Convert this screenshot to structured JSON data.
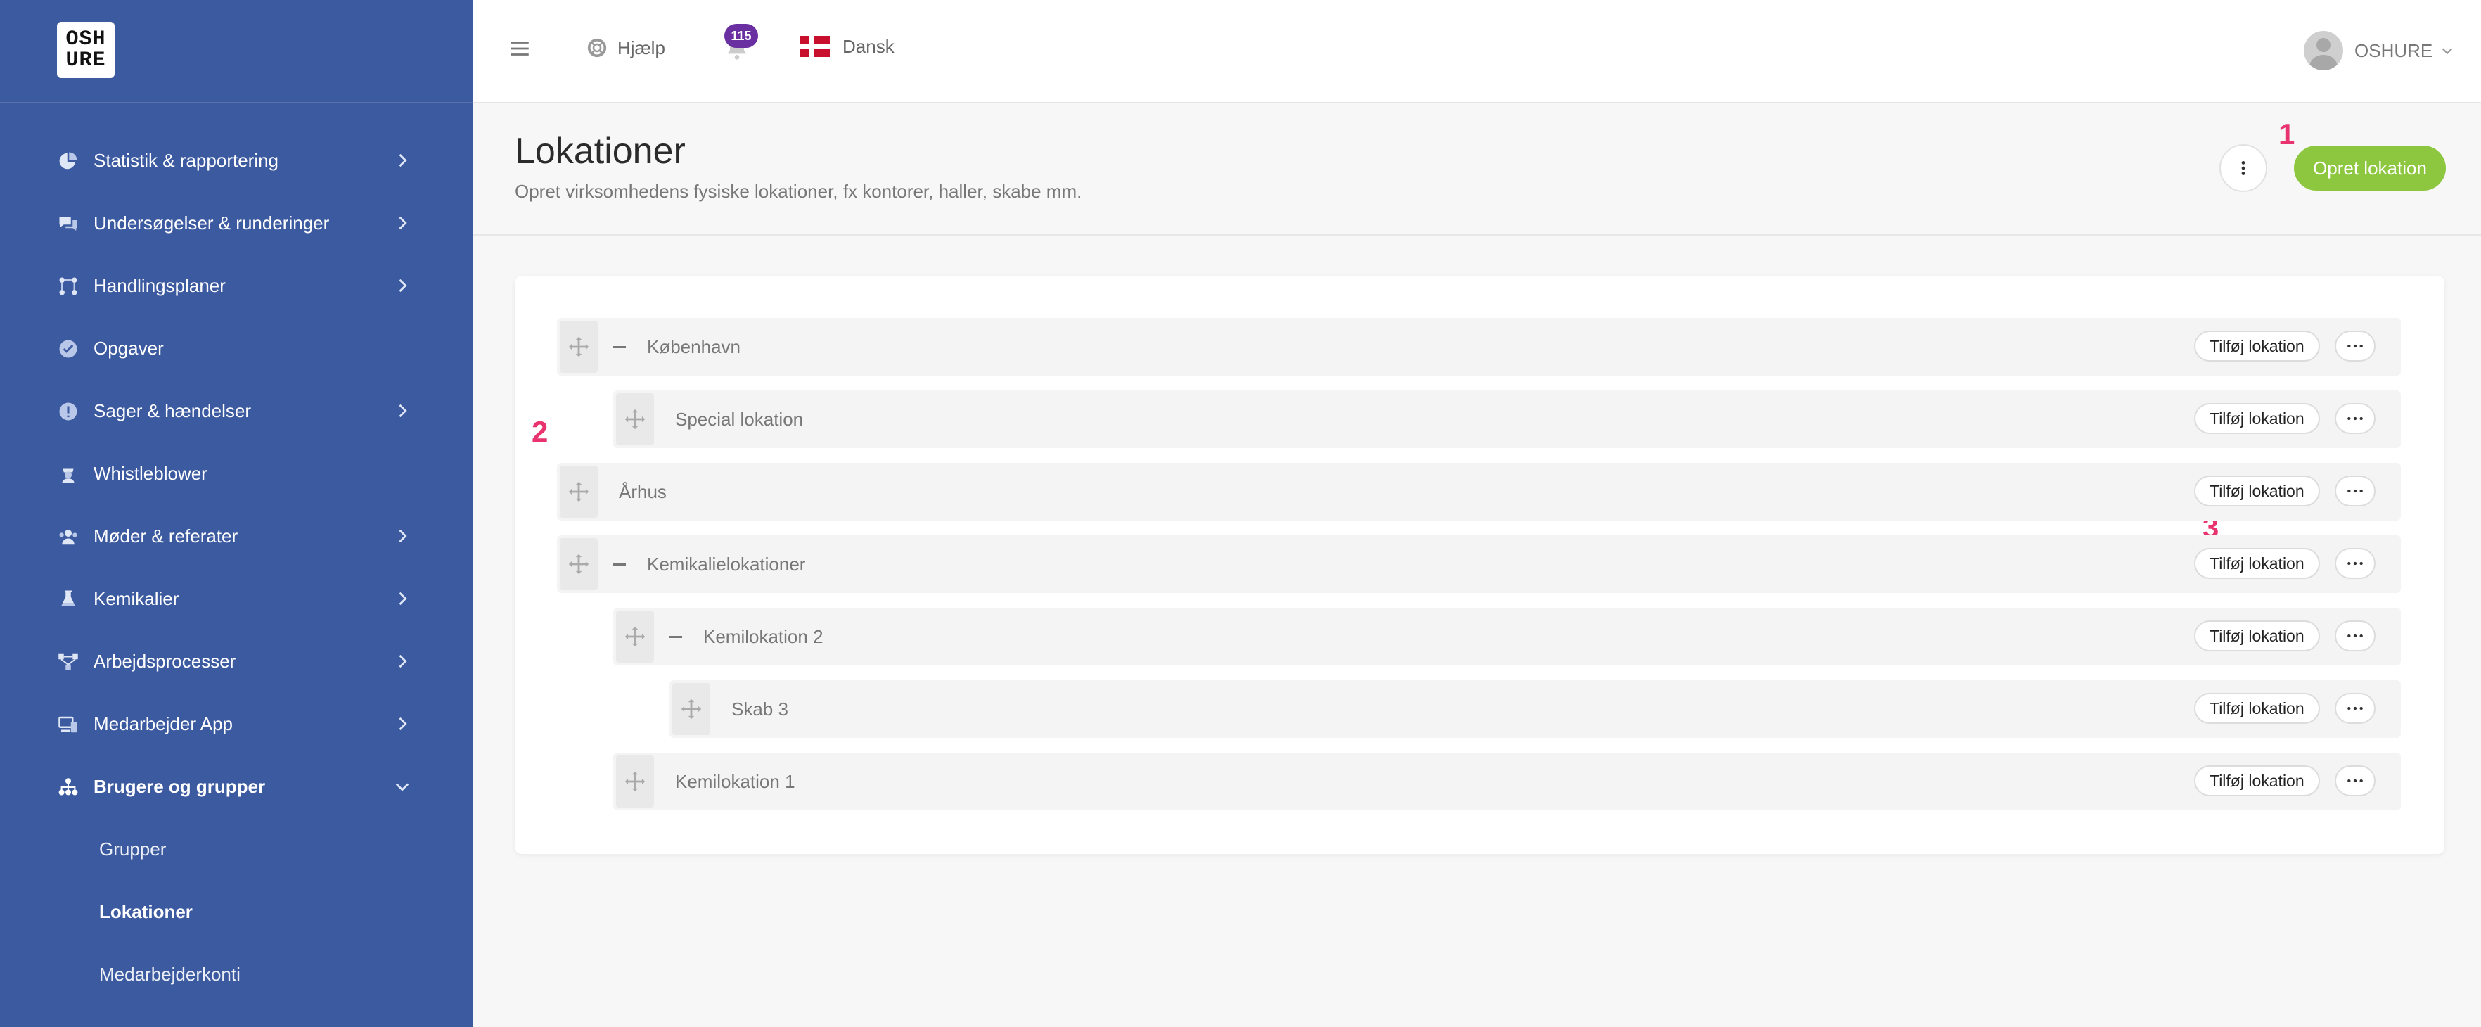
{
  "logo": {
    "line1": "OSH",
    "line2": "URE"
  },
  "sidebar": {
    "items": [
      {
        "label": "Statistik & rapportering",
        "icon": "pie-chart-icon"
      },
      {
        "label": "Undersøgelser & runderinger",
        "icon": "chat-bubbles-icon"
      },
      {
        "label": "Handlingsplaner",
        "icon": "action-plan-icon"
      },
      {
        "label": "Opgaver",
        "icon": "check-circle-icon"
      },
      {
        "label": "Sager & hændelser",
        "icon": "alert-circle-icon"
      },
      {
        "label": "Whistleblower",
        "icon": "whistleblower-icon"
      },
      {
        "label": "Møder & referater",
        "icon": "people-icon"
      },
      {
        "label": "Kemikalier",
        "icon": "flask-icon"
      },
      {
        "label": "Arbejdsprocesser",
        "icon": "process-icon"
      },
      {
        "label": "Medarbejder App",
        "icon": "devices-icon"
      },
      {
        "label": "Brugere og grupper",
        "icon": "org-chart-icon"
      }
    ],
    "subitems": [
      "Grupper",
      "Lokationer",
      "Medarbejderkonti"
    ]
  },
  "topbar": {
    "help_label": "Hjælp",
    "notification_count": "115",
    "language_label": "Dansk",
    "user_name": "OSHURE"
  },
  "page": {
    "title": "Lokationer",
    "subtitle": "Opret virksomhedens fysiske lokationer, fx kontorer, haller, skabe mm.",
    "create_button": "Opret lokation"
  },
  "annotations": [
    "1",
    "2",
    "3"
  ],
  "locations": {
    "add_label": "Tilføj lokation",
    "rows": [
      {
        "label": "København"
      },
      {
        "label": "Special lokation"
      },
      {
        "label": "Århus"
      },
      {
        "label": "Kemikalielokationer"
      },
      {
        "label": "Kemilokation 2"
      },
      {
        "label": "Skab 3"
      },
      {
        "label": "Kemilokation 1"
      }
    ]
  },
  "colors": {
    "sidebar_bg": "#3c5aa0",
    "primary_button": "#8dc63f",
    "badge": "#6a2fa0",
    "annotation": "#e8336e"
  }
}
